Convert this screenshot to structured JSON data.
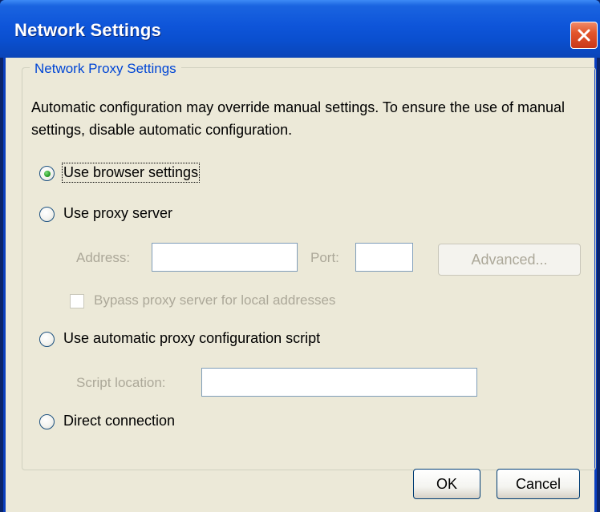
{
  "window": {
    "title": "Network Settings"
  },
  "group": {
    "legend": "Network Proxy Settings",
    "info_text": "Automatic configuration may override manual settings. To ensure the use of manual settings, disable automatic configuration."
  },
  "options": {
    "browser": {
      "label": "Use browser settings",
      "selected": true
    },
    "proxy": {
      "label": "Use proxy server",
      "selected": false
    },
    "auto_script": {
      "label": "Use automatic proxy configuration script",
      "selected": false
    },
    "direct": {
      "label": "Direct connection",
      "selected": false
    }
  },
  "proxy_fields": {
    "address_label": "Address:",
    "address_value": "",
    "port_label": "Port:",
    "port_value": "",
    "advanced_label": "Advanced...",
    "bypass_label": "Bypass proxy server for local addresses",
    "bypass_checked": false
  },
  "script_fields": {
    "location_label": "Script location:",
    "location_value": ""
  },
  "buttons": {
    "ok_label": "OK",
    "cancel_label": "Cancel"
  },
  "colors": {
    "title_bar": "#0a4fcf",
    "dialog_bg": "#ece9d8",
    "legend_text": "#0046d5",
    "disabled_text": "#aca899",
    "close_button": "#e3562c"
  }
}
